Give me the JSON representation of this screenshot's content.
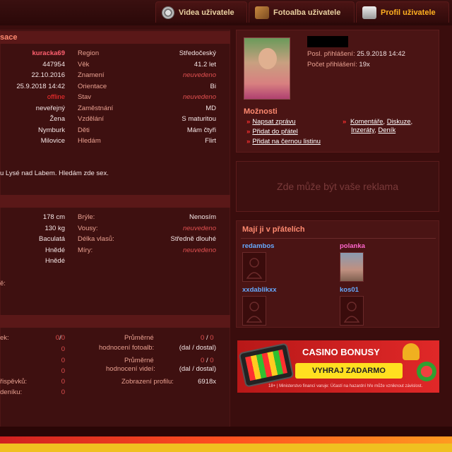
{
  "nav": {
    "tabs": [
      {
        "label": "Videa uživatele",
        "icon": "film-reel-icon"
      },
      {
        "label": "Fotoalba uživatele",
        "icon": "photo-album-icon"
      },
      {
        "label": "Profil uživatele",
        "icon": "user-profile-icon"
      }
    ]
  },
  "info": {
    "section_title": "sace",
    "left_values": [
      "kuracka69",
      "447954",
      "22.10.2016",
      "25.9.2018 14:42",
      "offline",
      "neveřejný",
      "Žena",
      "Nymburk",
      "Milovice"
    ],
    "right_rows": [
      {
        "label": "Region",
        "value": "Středočeský"
      },
      {
        "label": "Věk",
        "value": "41.2 let"
      },
      {
        "label": "Znamení",
        "value": "neuvedeno"
      },
      {
        "label": "Orientace",
        "value": "Bi"
      },
      {
        "label": "Stav",
        "value": "neuvedeno"
      },
      {
        "label": "Zaměstnání",
        "value": "MD"
      },
      {
        "label": "Vzdělání",
        "value": "S maturitou"
      },
      {
        "label": "Děti",
        "value": "Mám čtyři"
      },
      {
        "label": "Hledám",
        "value": "Flirt"
      }
    ],
    "description": "u Lysé nad Labem. Hledám zde sex."
  },
  "appearance": {
    "left_values": [
      "178 cm",
      "130 kg",
      "Baculatá",
      "Hnědé",
      "Hnědé"
    ],
    "right_rows": [
      {
        "label": "Brýle:",
        "value": "Nenosím"
      },
      {
        "label": "Vousy:",
        "value": "neuvedeno"
      },
      {
        "label": "Délka vlasů:",
        "value": "Středně dlouhé"
      },
      {
        "label": "Míry:",
        "value": "neuvedeno"
      }
    ],
    "trailing_label": "ě:"
  },
  "stats": {
    "left_rows": [
      {
        "label": "ek:",
        "value": "0",
        "extra": "0"
      },
      {
        "label": "",
        "value": "0"
      },
      {
        "label": "",
        "value": "0"
      },
      {
        "label": "",
        "value": "0"
      },
      {
        "label": "řispěvků:",
        "value": "0"
      },
      {
        "label": "deníku:",
        "value": "0"
      }
    ],
    "photo_rating_label_1": "Průměrné",
    "photo_rating_label_2": "hodnocení fotoalb:",
    "photo_rating_value": "0",
    "photo_rating_value2": "0",
    "photo_rating_note": "(dal / dostal)",
    "video_rating_label_1": "Průměrné",
    "video_rating_label_2": "hodnocení videí:",
    "video_rating_value": "0",
    "video_rating_value2": "0",
    "video_rating_note": "(dal / dostal)",
    "views_label": "Zobrazení profilu:",
    "views_value": "6918x",
    "slash": "/"
  },
  "profile_card": {
    "last_login_label": "Posl. přihlášení:",
    "last_login_value": "25.9.2018 14:42",
    "login_count_label": "Počet přihlášení:",
    "login_count_value": "19x",
    "options_title": "Možnosti",
    "options_left": [
      "Napsat zprávu",
      "Přidat do přátel",
      "Přidat na černou listinu"
    ],
    "options_right_line1": [
      "Komentáře",
      "Diskuze"
    ],
    "options_right_line2": [
      "Inzeráty",
      "Deník"
    ]
  },
  "ad_placeholder": "Zde může být vaše reklama",
  "friends": {
    "title": "Mají ji v přátelích",
    "items": [
      {
        "name": "redambos",
        "color": "#66aaff"
      },
      {
        "name": "polanka",
        "color": "#ff66cc"
      },
      {
        "name": "xxdablikxx",
        "color": "#66aaff"
      },
      {
        "name": "kos01",
        "color": "#66aaff"
      }
    ]
  },
  "banner": {
    "title": "CASINO BONUSY",
    "cta": "VYHRAJ ZADARMO",
    "disclaimer": "18+ | Ministerstvo financí varuje: Účastí na hazardní hře může vzniknout závislost."
  }
}
